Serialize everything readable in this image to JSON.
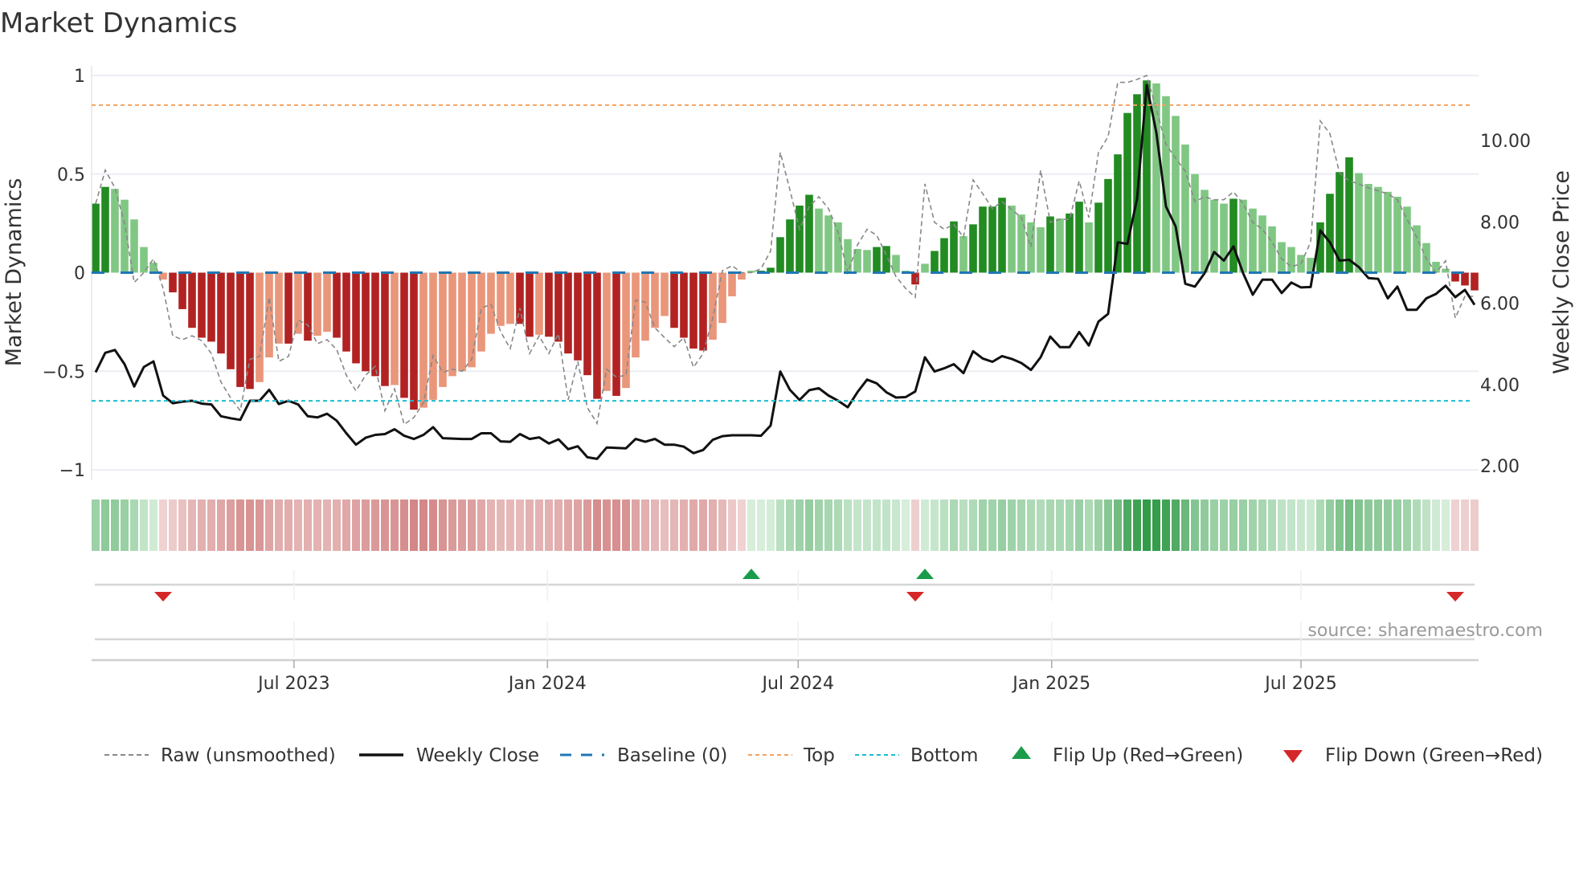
{
  "chart_data": {
    "type": "bar",
    "title": "Market Dynamics",
    "ylabel_left": "Market Dynamics",
    "ylabel_right": "Weekly Close Price",
    "ylim_left": [
      -1,
      1
    ],
    "ylim_right": [
      2,
      11.4
    ],
    "yticks_left": [
      {
        "value": 1,
        "label": "1"
      },
      {
        "value": 0.5,
        "label": "0.5"
      },
      {
        "value": 0,
        "label": "0"
      },
      {
        "value": -0.5,
        "label": "−0.5"
      },
      {
        "value": -1,
        "label": "−1"
      }
    ],
    "yticks_right": [
      {
        "value": 10,
        "label": "10.00"
      },
      {
        "value": 8,
        "label": "8.00"
      },
      {
        "value": 6,
        "label": "6.00"
      },
      {
        "value": 4,
        "label": "4.00"
      },
      {
        "value": 2,
        "label": "2.00"
      }
    ],
    "xticks": [
      {
        "date": "2023-07-01",
        "label": "Jul 2023"
      },
      {
        "date": "2024-01-01",
        "label": "Jan 2024"
      },
      {
        "date": "2024-07-01",
        "label": "Jul 2024"
      },
      {
        "date": "2025-01-01",
        "label": "Jan 2025"
      },
      {
        "date": "2025-07-01",
        "label": "Jul 2025"
      }
    ],
    "x_start": "2023-02-07",
    "x_step_days": 7,
    "top_level": 0.85,
    "bottom_level": -0.65,
    "baseline": 0,
    "colors": {
      "strong_up": "#228b22",
      "weak_up": "#81c784",
      "strong_down": "#b22222",
      "weak_down": "#e9967a",
      "raw": "#888888",
      "close": "#111111",
      "baseline": "#1f77b4",
      "top": "#f4a261",
      "bottom": "#17becf",
      "flip_up": "#1a9c4a",
      "flip_down": "#d62728"
    },
    "series": [
      {
        "name": "Market Dynamics (smoothed)",
        "values": [
          0.35,
          0.435,
          0.425,
          0.37,
          0.27,
          0.13,
          0.05,
          -0.035,
          -0.1,
          -0.185,
          -0.28,
          -0.33,
          -0.35,
          -0.41,
          -0.49,
          -0.58,
          -0.59,
          -0.555,
          -0.43,
          -0.36,
          -0.36,
          -0.31,
          -0.345,
          -0.32,
          -0.3,
          -0.33,
          -0.4,
          -0.46,
          -0.5,
          -0.525,
          -0.575,
          -0.57,
          -0.635,
          -0.695,
          -0.685,
          -0.645,
          -0.58,
          -0.525,
          -0.5,
          -0.48,
          -0.4,
          -0.31,
          -0.27,
          -0.26,
          -0.26,
          -0.325,
          -0.315,
          -0.325,
          -0.35,
          -0.41,
          -0.445,
          -0.52,
          -0.64,
          -0.6,
          -0.625,
          -0.585,
          -0.43,
          -0.345,
          -0.28,
          -0.22,
          -0.28,
          -0.33,
          -0.385,
          -0.395,
          -0.34,
          -0.255,
          -0.12,
          -0.035,
          0.01,
          0.01,
          0.025,
          0.18,
          0.27,
          0.34,
          0.395,
          0.325,
          0.29,
          0.255,
          0.17,
          0.12,
          0.115,
          0.13,
          0.135,
          0.09,
          0.01,
          -0.06,
          0.045,
          0.11,
          0.175,
          0.26,
          0.185,
          0.245,
          0.335,
          0.335,
          0.38,
          0.34,
          0.295,
          0.255,
          0.23,
          0.285,
          0.275,
          0.3,
          0.36,
          0.255,
          0.355,
          0.475,
          0.6,
          0.81,
          0.905,
          0.975,
          0.96,
          0.895,
          0.795,
          0.65,
          0.5,
          0.42,
          0.37,
          0.35,
          0.375,
          0.37,
          0.325,
          0.29,
          0.235,
          0.155,
          0.13,
          0.09,
          0.075,
          0.255,
          0.4,
          0.51,
          0.585,
          0.505,
          0.45,
          0.435,
          0.41,
          0.385,
          0.335,
          0.24,
          0.15,
          0.055,
          0.02,
          -0.045,
          -0.065,
          -0.09
        ]
      },
      {
        "name": "Raw (unsmoothed)",
        "values": [
          0.35,
          0.52,
          0.43,
          0.25,
          -0.05,
          0.0,
          0.07,
          -0.08,
          -0.32,
          -0.34,
          -0.32,
          -0.345,
          -0.41,
          -0.555,
          -0.635,
          -0.7,
          -0.44,
          -0.425,
          -0.125,
          -0.45,
          -0.425,
          -0.24,
          -0.265,
          -0.36,
          -0.34,
          -0.39,
          -0.52,
          -0.6,
          -0.52,
          -0.475,
          -0.7,
          -0.59,
          -0.77,
          -0.735,
          -0.66,
          -0.42,
          -0.505,
          -0.49,
          -0.5,
          -0.44,
          -0.18,
          -0.16,
          -0.3,
          -0.385,
          -0.18,
          -0.41,
          -0.32,
          -0.41,
          -0.31,
          -0.645,
          -0.45,
          -0.685,
          -0.765,
          -0.49,
          -0.53,
          -0.52,
          -0.14,
          -0.15,
          -0.28,
          -0.33,
          -0.375,
          -0.33,
          -0.48,
          -0.41,
          -0.23,
          0.01,
          0.035,
          0.0,
          0.0,
          0.02,
          0.11,
          0.61,
          0.42,
          0.22,
          0.335,
          0.385,
          0.325,
          0.205,
          0.0,
          0.14,
          0.22,
          0.19,
          0.09,
          -0.02,
          -0.08,
          -0.125,
          0.45,
          0.255,
          0.22,
          0.245,
          0.18,
          0.47,
          0.4,
          0.325,
          0.36,
          0.32,
          0.28,
          0.13,
          0.52,
          0.255,
          0.27,
          0.27,
          0.465,
          0.28,
          0.61,
          0.69,
          0.965,
          0.965,
          0.98,
          1.0,
          0.83,
          0.65,
          0.58,
          0.515,
          0.36,
          0.385,
          0.37,
          0.37,
          0.41,
          0.35,
          0.255,
          0.22,
          0.155,
          0.07,
          0.03,
          0.045,
          0.155,
          0.77,
          0.705,
          0.505,
          0.465,
          0.45,
          0.43,
          0.415,
          0.4,
          0.37,
          0.27,
          0.18,
          0.07,
          0.0,
          0.06,
          -0.23,
          -0.12,
          -0.12
        ]
      },
      {
        "name": "Weekly Close",
        "axis": "right",
        "values": [
          4.3,
          4.78,
          4.85,
          4.5,
          3.95,
          4.43,
          4.57,
          3.73,
          3.54,
          3.58,
          3.6,
          3.53,
          3.51,
          3.22,
          3.17,
          3.13,
          3.6,
          3.6,
          3.87,
          3.52,
          3.6,
          3.51,
          3.22,
          3.19,
          3.28,
          3.11,
          2.8,
          2.52,
          2.69,
          2.76,
          2.78,
          2.9,
          2.74,
          2.66,
          2.76,
          2.95,
          2.68,
          2.67,
          2.66,
          2.66,
          2.8,
          2.8,
          2.6,
          2.59,
          2.78,
          2.66,
          2.7,
          2.55,
          2.65,
          2.41,
          2.48,
          2.21,
          2.17,
          2.45,
          2.44,
          2.43,
          2.66,
          2.59,
          2.66,
          2.52,
          2.52,
          2.47,
          2.31,
          2.39,
          2.64,
          2.73,
          2.75,
          2.75,
          2.75,
          2.74,
          2.99,
          4.32,
          3.87,
          3.62,
          3.86,
          3.91,
          3.73,
          3.6,
          3.44,
          3.81,
          4.12,
          4.03,
          3.81,
          3.68,
          3.69,
          3.83,
          4.67,
          4.32,
          4.4,
          4.5,
          4.28,
          4.82,
          4.64,
          4.56,
          4.7,
          4.63,
          4.53,
          4.36,
          4.67,
          5.18,
          4.92,
          4.92,
          5.29,
          4.96,
          5.55,
          5.74,
          7.5,
          7.46,
          8.57,
          11.37,
          10.2,
          8.38,
          7.89,
          6.48,
          6.41,
          6.74,
          7.26,
          7.05,
          7.4,
          6.74,
          6.21,
          6.58,
          6.58,
          6.25,
          6.51,
          6.39,
          6.4,
          7.79,
          7.5,
          7.05,
          7.07,
          6.89,
          6.62,
          6.6,
          6.12,
          6.41,
          5.84,
          5.84,
          6.12,
          6.23,
          6.43,
          6.15,
          6.33,
          5.96
        ]
      }
    ],
    "legend": {
      "placement": "bottom",
      "items": [
        {
          "key": "raw",
          "label": "Raw (unsmoothed)"
        },
        {
          "key": "close",
          "label": "Weekly Close"
        },
        {
          "key": "baseline",
          "label": "Baseline (0)"
        },
        {
          "key": "top",
          "label": "Top"
        },
        {
          "key": "bottom",
          "label": "Bottom"
        },
        {
          "key": "flip_up",
          "label": "Flip Up (Red→Green)"
        },
        {
          "key": "flip_down",
          "label": "Flip Down (Green→Red)"
        }
      ]
    },
    "source": "source: sharemaestro.com"
  }
}
